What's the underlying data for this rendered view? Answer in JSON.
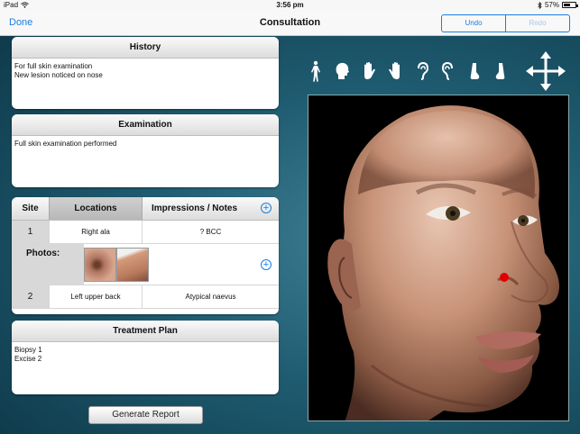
{
  "status_bar": {
    "device": "iPad",
    "time": "3:56 pm",
    "battery": "57%",
    "battery_level": 0.57
  },
  "nav": {
    "done": "Done",
    "title": "Consultation",
    "undo": "Undo",
    "redo": "Redo"
  },
  "history": {
    "title": "History",
    "lines": [
      "For full skin examination",
      "New lesion noticed on nose"
    ]
  },
  "examination": {
    "title": "Examination",
    "lines": [
      "Full skin examination performed"
    ]
  },
  "locations_table": {
    "headers": {
      "site": "Site",
      "locations": "Locations",
      "impressions": "Impressions / Notes"
    },
    "rows": [
      {
        "site": "1",
        "location": "Right ala",
        "impression": "? BCC"
      },
      {
        "site": "2",
        "location": "Left upper back",
        "impression": "Atypical naevus"
      }
    ],
    "photos_label": "Photos:"
  },
  "treatment_plan": {
    "title": "Treatment Plan",
    "lines": [
      "Biopsy 1",
      "Excise 2"
    ]
  },
  "body_part_icons": [
    "full-body-icon",
    "head-icon",
    "hand-back-icon",
    "hand-palm-icon",
    "ear-left-icon",
    "ear-right-icon",
    "foot-left-icon",
    "foot-right-icon"
  ],
  "generate_report": "Generate Report",
  "colors": {
    "accent": "#1a7ee0",
    "background": "#1f5b70",
    "lesion_marker": "#e00000"
  }
}
